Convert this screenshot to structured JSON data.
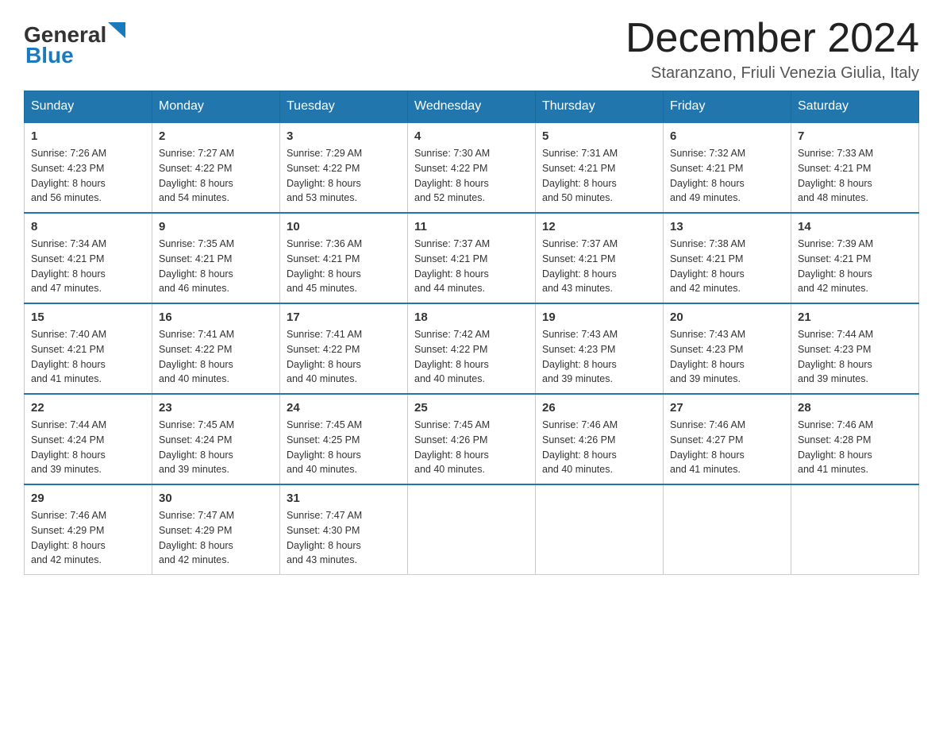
{
  "header": {
    "logo_text_general": "General",
    "logo_text_blue": "Blue",
    "month_title": "December 2024",
    "subtitle": "Staranzano, Friuli Venezia Giulia, Italy"
  },
  "weekdays": [
    "Sunday",
    "Monday",
    "Tuesday",
    "Wednesday",
    "Thursday",
    "Friday",
    "Saturday"
  ],
  "weeks": [
    [
      {
        "day": "1",
        "sunrise": "7:26 AM",
        "sunset": "4:23 PM",
        "daylight": "8 hours and 56 minutes."
      },
      {
        "day": "2",
        "sunrise": "7:27 AM",
        "sunset": "4:22 PM",
        "daylight": "8 hours and 54 minutes."
      },
      {
        "day": "3",
        "sunrise": "7:29 AM",
        "sunset": "4:22 PM",
        "daylight": "8 hours and 53 minutes."
      },
      {
        "day": "4",
        "sunrise": "7:30 AM",
        "sunset": "4:22 PM",
        "daylight": "8 hours and 52 minutes."
      },
      {
        "day": "5",
        "sunrise": "7:31 AM",
        "sunset": "4:21 PM",
        "daylight": "8 hours and 50 minutes."
      },
      {
        "day": "6",
        "sunrise": "7:32 AM",
        "sunset": "4:21 PM",
        "daylight": "8 hours and 49 minutes."
      },
      {
        "day": "7",
        "sunrise": "7:33 AM",
        "sunset": "4:21 PM",
        "daylight": "8 hours and 48 minutes."
      }
    ],
    [
      {
        "day": "8",
        "sunrise": "7:34 AM",
        "sunset": "4:21 PM",
        "daylight": "8 hours and 47 minutes."
      },
      {
        "day": "9",
        "sunrise": "7:35 AM",
        "sunset": "4:21 PM",
        "daylight": "8 hours and 46 minutes."
      },
      {
        "day": "10",
        "sunrise": "7:36 AM",
        "sunset": "4:21 PM",
        "daylight": "8 hours and 45 minutes."
      },
      {
        "day": "11",
        "sunrise": "7:37 AM",
        "sunset": "4:21 PM",
        "daylight": "8 hours and 44 minutes."
      },
      {
        "day": "12",
        "sunrise": "7:37 AM",
        "sunset": "4:21 PM",
        "daylight": "8 hours and 43 minutes."
      },
      {
        "day": "13",
        "sunrise": "7:38 AM",
        "sunset": "4:21 PM",
        "daylight": "8 hours and 42 minutes."
      },
      {
        "day": "14",
        "sunrise": "7:39 AM",
        "sunset": "4:21 PM",
        "daylight": "8 hours and 42 minutes."
      }
    ],
    [
      {
        "day": "15",
        "sunrise": "7:40 AM",
        "sunset": "4:21 PM",
        "daylight": "8 hours and 41 minutes."
      },
      {
        "day": "16",
        "sunrise": "7:41 AM",
        "sunset": "4:22 PM",
        "daylight": "8 hours and 40 minutes."
      },
      {
        "day": "17",
        "sunrise": "7:41 AM",
        "sunset": "4:22 PM",
        "daylight": "8 hours and 40 minutes."
      },
      {
        "day": "18",
        "sunrise": "7:42 AM",
        "sunset": "4:22 PM",
        "daylight": "8 hours and 40 minutes."
      },
      {
        "day": "19",
        "sunrise": "7:43 AM",
        "sunset": "4:23 PM",
        "daylight": "8 hours and 39 minutes."
      },
      {
        "day": "20",
        "sunrise": "7:43 AM",
        "sunset": "4:23 PM",
        "daylight": "8 hours and 39 minutes."
      },
      {
        "day": "21",
        "sunrise": "7:44 AM",
        "sunset": "4:23 PM",
        "daylight": "8 hours and 39 minutes."
      }
    ],
    [
      {
        "day": "22",
        "sunrise": "7:44 AM",
        "sunset": "4:24 PM",
        "daylight": "8 hours and 39 minutes."
      },
      {
        "day": "23",
        "sunrise": "7:45 AM",
        "sunset": "4:24 PM",
        "daylight": "8 hours and 39 minutes."
      },
      {
        "day": "24",
        "sunrise": "7:45 AM",
        "sunset": "4:25 PM",
        "daylight": "8 hours and 40 minutes."
      },
      {
        "day": "25",
        "sunrise": "7:45 AM",
        "sunset": "4:26 PM",
        "daylight": "8 hours and 40 minutes."
      },
      {
        "day": "26",
        "sunrise": "7:46 AM",
        "sunset": "4:26 PM",
        "daylight": "8 hours and 40 minutes."
      },
      {
        "day": "27",
        "sunrise": "7:46 AM",
        "sunset": "4:27 PM",
        "daylight": "8 hours and 41 minutes."
      },
      {
        "day": "28",
        "sunrise": "7:46 AM",
        "sunset": "4:28 PM",
        "daylight": "8 hours and 41 minutes."
      }
    ],
    [
      {
        "day": "29",
        "sunrise": "7:46 AM",
        "sunset": "4:29 PM",
        "daylight": "8 hours and 42 minutes."
      },
      {
        "day": "30",
        "sunrise": "7:47 AM",
        "sunset": "4:29 PM",
        "daylight": "8 hours and 42 minutes."
      },
      {
        "day": "31",
        "sunrise": "7:47 AM",
        "sunset": "4:30 PM",
        "daylight": "8 hours and 43 minutes."
      },
      null,
      null,
      null,
      null
    ]
  ],
  "labels": {
    "sunrise": "Sunrise:",
    "sunset": "Sunset:",
    "daylight": "Daylight:"
  }
}
